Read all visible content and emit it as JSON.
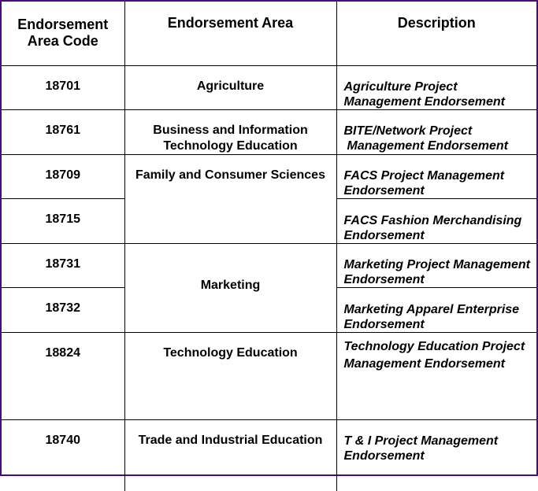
{
  "headers": {
    "code": "Endorsement Area Code",
    "area": "Endorsement Area",
    "description": "Description"
  },
  "rows": [
    {
      "code": "18701",
      "area": "Agriculture",
      "description": "Agriculture Project Management Endorsement"
    },
    {
      "code": "18761",
      "area": "Business and Information Technology Education",
      "description": "BITE/Network Project Management Endorsement"
    },
    {
      "code": "18709",
      "area": "Family and Consumer Sciences",
      "description": "FACS Project Management Endorsement"
    },
    {
      "code": "18715",
      "area": "Family and Consumer Sciences",
      "description": "FACS Fashion Merchandising Endorsement"
    },
    {
      "code": "18731",
      "area": "Marketing",
      "description": "Marketing Project Management Endorsement"
    },
    {
      "code": "18732",
      "area": "Marketing",
      "description": "Marketing Apparel Enterprise Endorsement"
    },
    {
      "code": "18824",
      "area": "Technology Education",
      "description": "Technology Education Project Management Endorsement"
    },
    {
      "code": "18740",
      "area": "Trade and Industrial Education",
      "description": "T & I Project Management Endorsement"
    }
  ],
  "colors": {
    "frame": "#4b0a80",
    "grid": "#000000"
  }
}
